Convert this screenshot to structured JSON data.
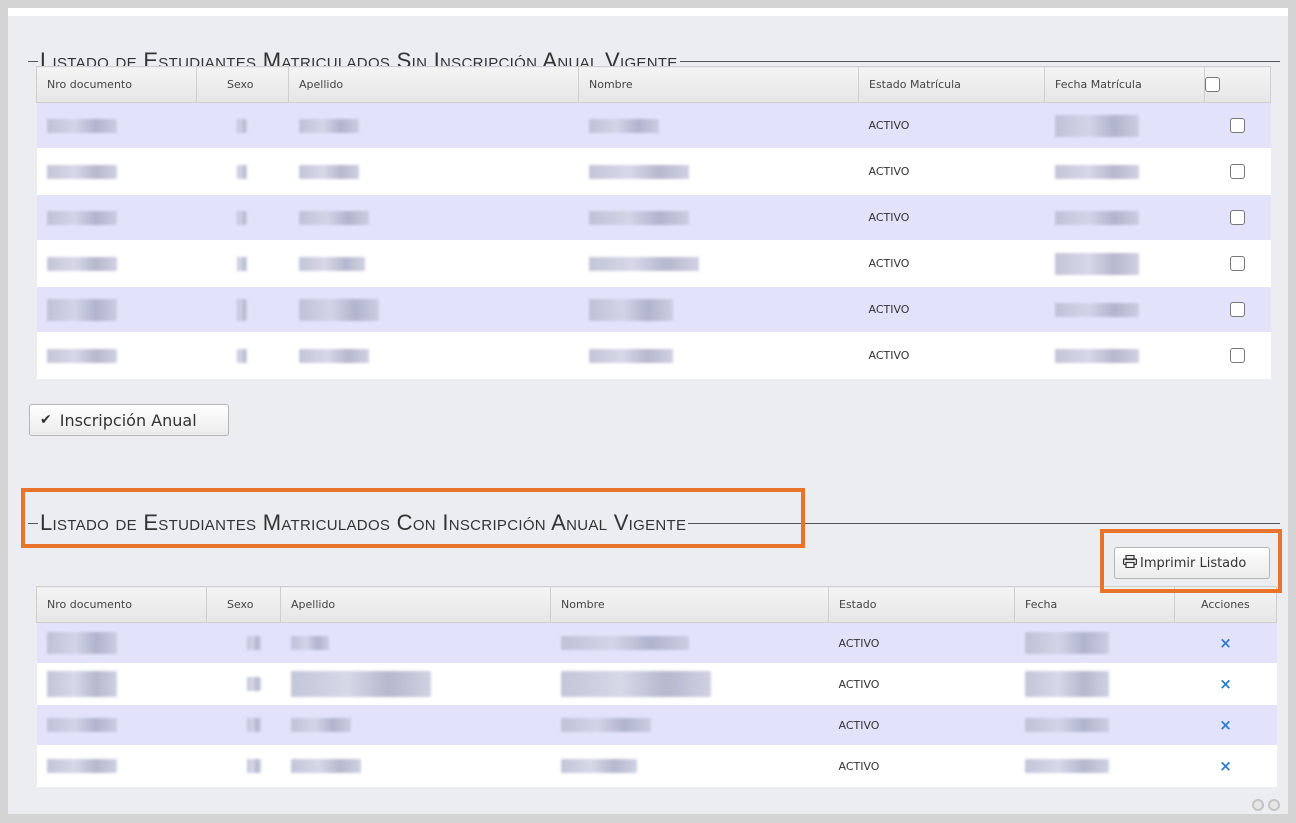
{
  "section1": {
    "title": "Listado de Estudiantes Matriculados Sin Inscripción Anual Vigente",
    "columns": [
      "Nro documento",
      "Sexo",
      "Apellido",
      "Nombre",
      "Estado Matrícula",
      "Fecha Matrícula"
    ],
    "rows": [
      {
        "estado": "ACTIVO"
      },
      {
        "estado": "ACTIVO"
      },
      {
        "estado": "ACTIVO"
      },
      {
        "estado": "ACTIVO"
      },
      {
        "estado": "ACTIVO"
      },
      {
        "estado": "ACTIVO"
      }
    ],
    "button_label": "Inscripción Anual"
  },
  "section2": {
    "title": "Listado de Estudiantes Matriculados Con Inscripción Anual Vigente",
    "print_button": "Imprimir Listado",
    "columns": [
      "Nro documento",
      "Sexo",
      "Apellido",
      "Nombre",
      "Estado",
      "Fecha",
      "Acciones"
    ],
    "rows": [
      {
        "estado": "ACTIVO",
        "action": "×"
      },
      {
        "estado": "ACTIVO",
        "action": "×"
      },
      {
        "estado": "ACTIVO",
        "action": "×"
      },
      {
        "estado": "ACTIVO",
        "action": "×"
      }
    ]
  },
  "icons": {
    "checkmark": "check-icon",
    "printer": "printer-icon",
    "delete": "close-icon"
  },
  "colors": {
    "highlight": "#e8742b",
    "row_alt": "#e2e3fb",
    "action_icon": "#2a7ed0"
  }
}
